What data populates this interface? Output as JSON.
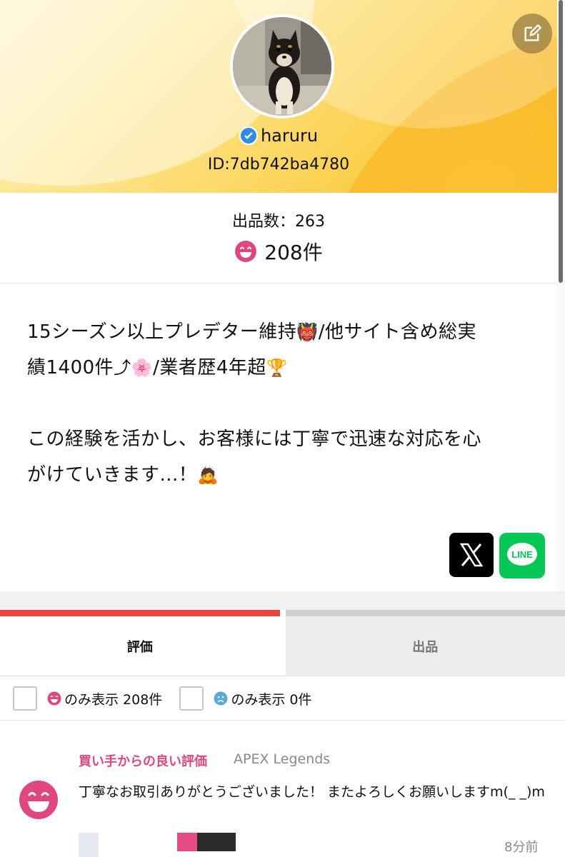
{
  "profile": {
    "username": "haruru",
    "id": "ID:7db742ba4780",
    "verified": true
  },
  "stats": {
    "listing_count": "出品数：263",
    "good_ratings": "208件"
  },
  "bio": {
    "paragraph1_line1": "15シーズン以上プレデター維持",
    "paragraph1_line1_b": "/他サイト含め総実",
    "paragraph1_line2": "績1400件",
    "paragraph1_line2_b": "/業者歴4年超",
    "paragraph2_line1": "この経験を活かし、お客様には丁寧で迅速な対応を心",
    "paragraph2_line2": "がけていきます...！"
  },
  "social": {
    "x_icon": "x-logo-icon",
    "line_label": "LINE"
  },
  "tabs": [
    {
      "label": "評価",
      "active": true
    },
    {
      "label": "出品",
      "active": false
    }
  ],
  "filters": {
    "good_label": "のみ表示 208件",
    "bad_label": "のみ表示 0件"
  },
  "review": {
    "title": "買い手からの良い評価",
    "game": "APEX Legends",
    "text": "丁寧なお取引ありがとうございました！ またよろしくお願いしますm(_ _)m",
    "time": "8分前"
  },
  "colors": {
    "accent_red": "#e8453a",
    "good_pink": "#e0467f",
    "line_green": "#06c755",
    "verified_blue": "#2f8be6"
  }
}
